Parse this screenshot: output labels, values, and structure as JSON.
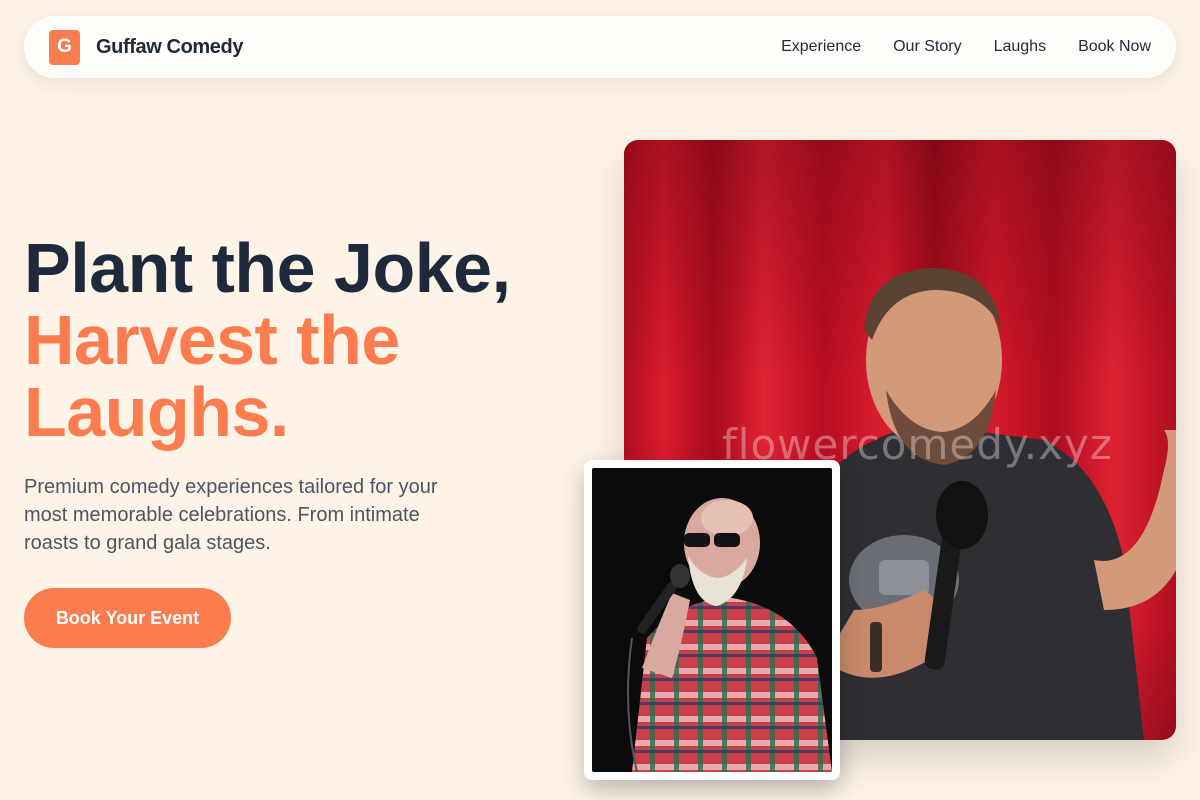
{
  "nav": {
    "logo_letter": "G",
    "brand": "Guffaw Comedy",
    "links": [
      "Experience",
      "Our Story",
      "Laughs",
      "Book Now"
    ]
  },
  "hero": {
    "title_line1": "Plant the Joke,",
    "title_line2": "Harvest the",
    "title_line3": "Laughs.",
    "subtitle": "Premium comedy experiences tailored for your most memorable celebrations. From intimate roasts to grand gala stages.",
    "cta_label": "Book Your Event"
  },
  "images": {
    "watermark": "flowercomedy.xyz"
  },
  "colors": {
    "accent": "#fb7c4f",
    "background": "#fdf3e6",
    "heading": "#1e293b"
  }
}
